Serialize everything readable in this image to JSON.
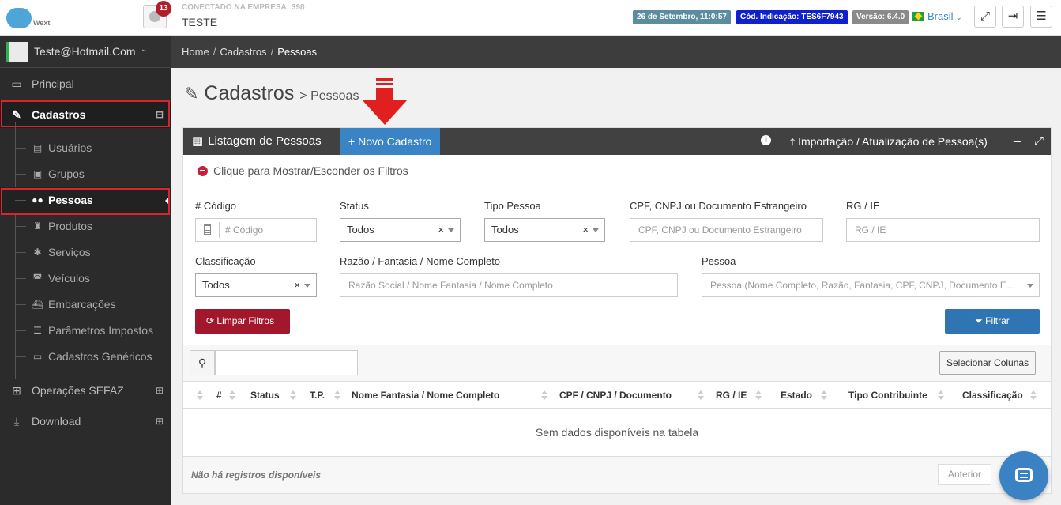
{
  "topbar": {
    "logo_label": "Wext",
    "notifications_count": "13",
    "connected_label": "CONECTADO NA EMPRESA: 398",
    "company": "TESTE",
    "datetime": "26 de Setembro, 11:0:57",
    "indicacao": "Cód. Indicação: TES6F7943",
    "version": "Versão: 6.4.0",
    "language": "Brasil",
    "icons": [
      "fullscreen-icon",
      "logout-icon",
      "menu-icon"
    ]
  },
  "sidebar": {
    "user": "Teste@Hotmail.Com",
    "items": [
      {
        "label": "Principal",
        "icon": "laptop-icon"
      },
      {
        "label": "Cadastros",
        "icon": "edit-icon",
        "expand": "⊟"
      },
      {
        "label": "Operações SEFAZ",
        "icon": "windows-icon",
        "expand": "⊞"
      },
      {
        "label": "Download",
        "icon": "download-icon",
        "expand": "⊞"
      }
    ],
    "subitems": [
      {
        "label": "Usuários",
        "icon": "id-card-icon"
      },
      {
        "label": "Grupos",
        "icon": "group-icon"
      },
      {
        "label": "Pessoas",
        "icon": "users-icon"
      },
      {
        "label": "Produtos",
        "icon": "product-icon"
      },
      {
        "label": "Serviços",
        "icon": "wrench-icon"
      },
      {
        "label": "Veículos",
        "icon": "car-icon"
      },
      {
        "label": "Embarcações",
        "icon": "ship-icon"
      },
      {
        "label": "Parâmetros Impostos",
        "icon": "sliders-icon"
      },
      {
        "label": "Cadastros Genéricos",
        "icon": "window-icon"
      }
    ]
  },
  "breadcrumb": [
    "Home",
    "Cadastros",
    "Pessoas"
  ],
  "page": {
    "title": "Cadastros",
    "subtitle": "> Pessoas"
  },
  "panel": {
    "title": "Listagem de Pessoas",
    "new_button": "Novo Cadastro",
    "import_button": "Importação / Atualização de Pessoa(s)",
    "filter_toggle": "Clique para Mostrar/Esconder os Filtros"
  },
  "filters": {
    "codigo_label": "# Código",
    "codigo_placeholder": "# Código",
    "status_label": "Status",
    "status_value": "Todos",
    "tipo_label": "Tipo Pessoa",
    "tipo_value": "Todos",
    "cpf_label": "CPF, CNPJ ou Documento Estrangeiro",
    "cpf_placeholder": "CPF, CNPJ ou Documento Estrangeiro",
    "rg_label": "RG / IE",
    "rg_placeholder": "RG / IE",
    "class_label": "Classificação",
    "class_value": "Todos",
    "razao_label": "Razão / Fantasia / Nome Completo",
    "razao_placeholder": "Razão Social / Nome Fantasia / Nome Completo",
    "pessoa_label": "Pessoa",
    "pessoa_placeholder": "Pessoa (Nome Completo, Razão, Fantasia, CPF, CNPJ, Documento Estrangeiro)",
    "clear_button": "Limpar Filtros",
    "filter_button": "Filtrar"
  },
  "table": {
    "select_columns": "Selecionar Colunas",
    "columns": [
      "#",
      "Status",
      "T.P.",
      "Nome Fantasia / Nome Completo",
      "CPF / CNPJ / Documento",
      "RG / IE",
      "Estado",
      "Tipo Contribuinte",
      "Classificação"
    ],
    "empty": "Sem dados disponíveis na tabela",
    "no_records": "Não há registros disponíveis",
    "prev": "Anterior"
  }
}
